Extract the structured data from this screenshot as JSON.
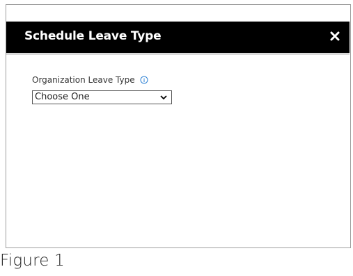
{
  "dialog": {
    "title": "Schedule Leave Type",
    "close_icon": "close-icon",
    "field": {
      "label": "Organization Leave Type",
      "info_icon": "info-icon",
      "select_value": "Choose One"
    }
  },
  "caption": "Figure 1",
  "colors": {
    "header_bg": "#000000",
    "header_text": "#ffffff",
    "info_icon": "#2a7fd4"
  }
}
